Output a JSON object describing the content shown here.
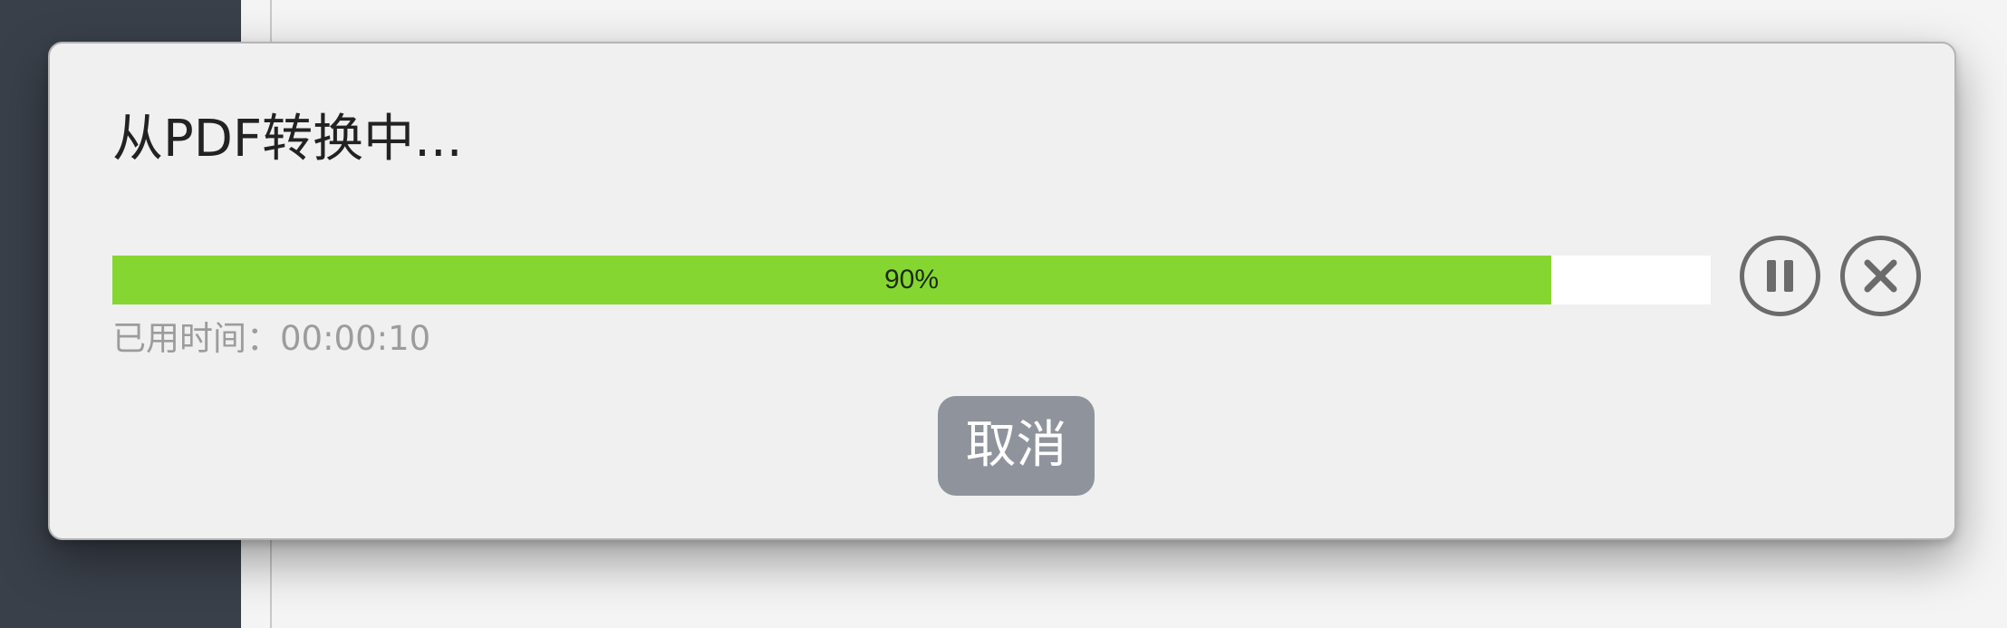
{
  "dialog": {
    "title": "从PDF转换中...",
    "progress": {
      "percent": 90,
      "label": "90%"
    },
    "elapsed_label": "已用时间：00:00:10",
    "cancel_label": "取消",
    "icons": {
      "pause": "pause-icon",
      "close": "close-icon"
    }
  },
  "colors": {
    "progress_fill": "#86d632",
    "progress_track": "#ffffff",
    "cancel_button": "#8f939b",
    "dialog_bg": "#f0f0f0",
    "sidebar_bg": "#3a404a",
    "icon_stroke": "#6b6b6b"
  }
}
